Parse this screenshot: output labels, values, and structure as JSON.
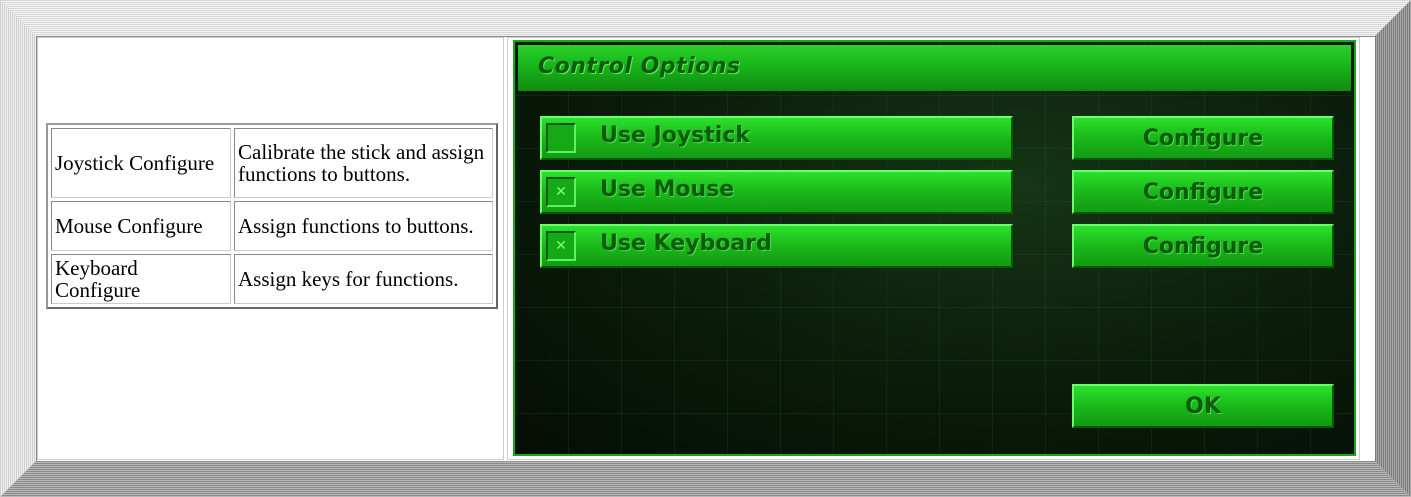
{
  "table": {
    "rows": [
      {
        "name": "Joystick Configure",
        "desc": "Calibrate the stick and assign functions to buttons."
      },
      {
        "name": "Mouse Configure",
        "desc": "Assign functions to buttons."
      },
      {
        "name": "Keyboard Configure",
        "desc": "Assign keys for functions."
      }
    ]
  },
  "dialog": {
    "title": "Control Options",
    "options": [
      {
        "label": "Use Joystick",
        "checked": false,
        "check_glyph": ""
      },
      {
        "label": "Use Mouse",
        "checked": true,
        "check_glyph": "✕"
      },
      {
        "label": "Use Keyboard",
        "checked": true,
        "check_glyph": "✕"
      }
    ],
    "configure_label": "Configure",
    "ok_label": "OK"
  },
  "colors": {
    "dialog_green": "#1ab81a",
    "dialog_text": "#0c5c0c",
    "dialog_background": "#0a1a0a"
  }
}
